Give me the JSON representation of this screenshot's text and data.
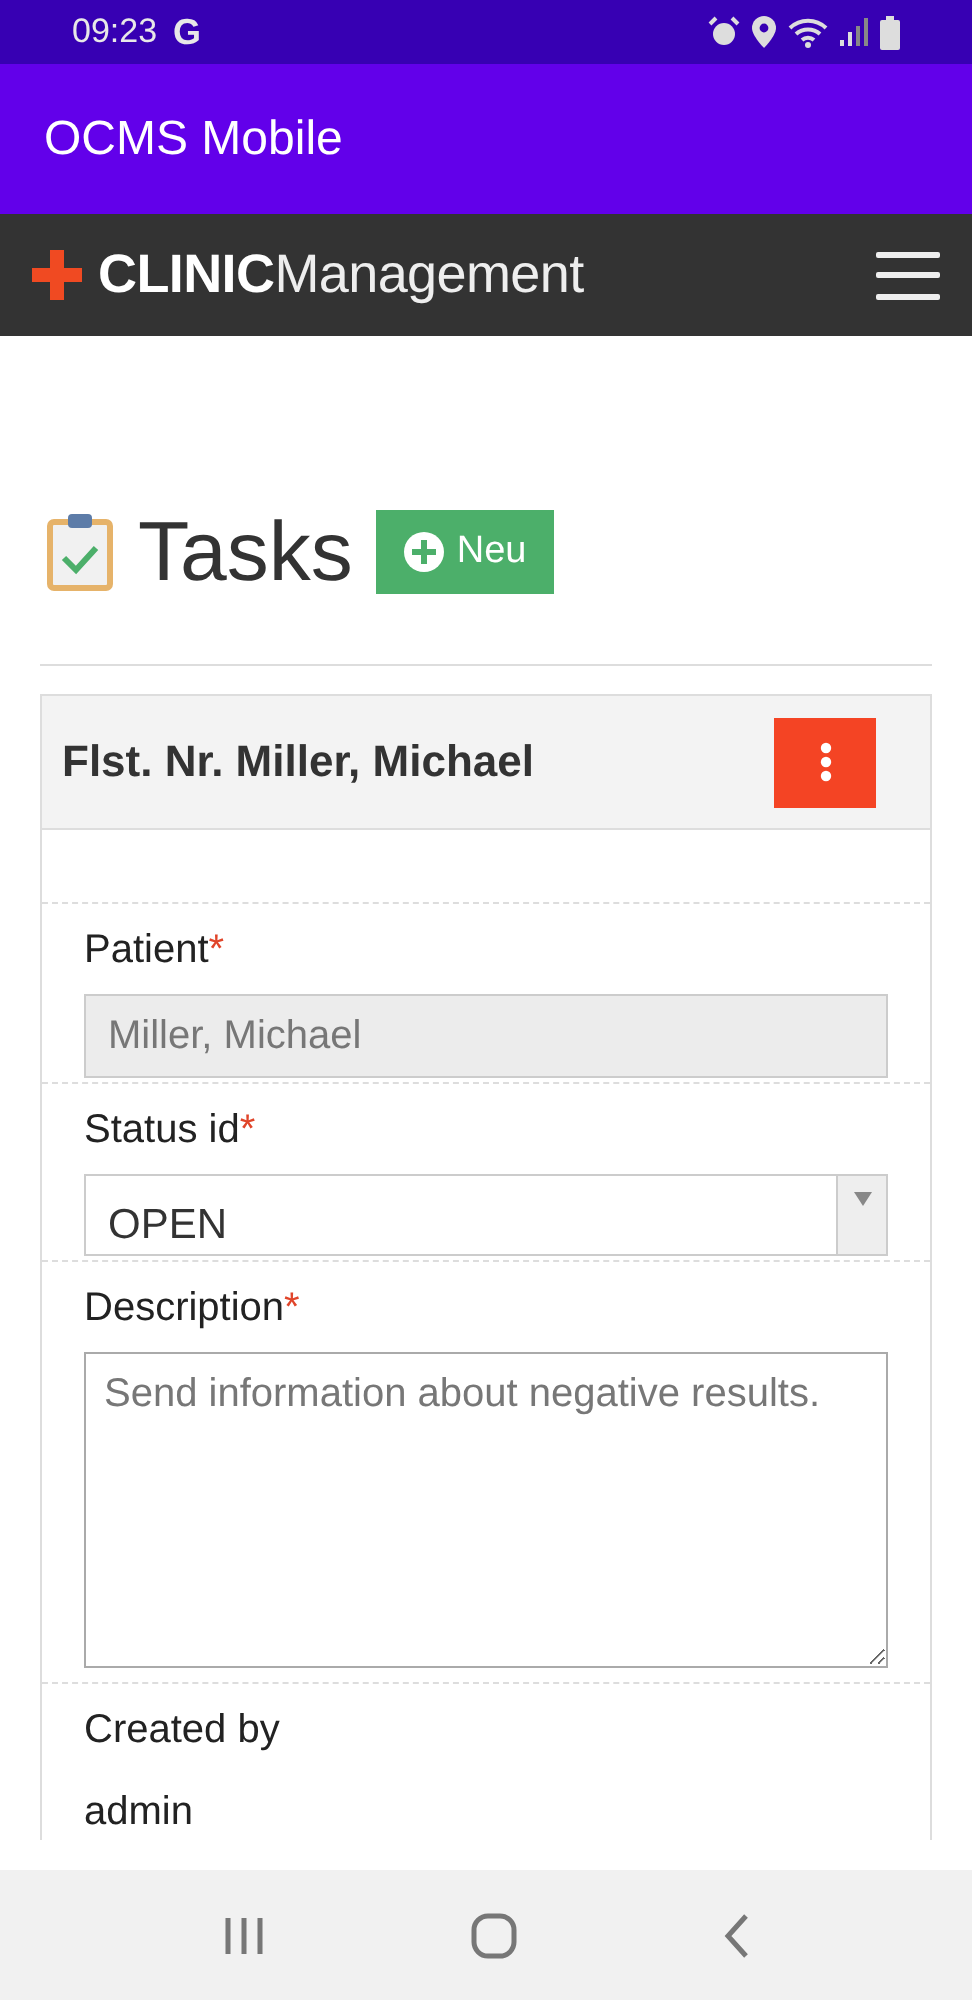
{
  "status_bar": {
    "time": "09:23",
    "notification": "G"
  },
  "app_bar": {
    "title": "OCMS Mobile"
  },
  "navbar": {
    "brand": "**CLINIC**Management"
  },
  "page": {
    "title": "Tasks",
    "new_button": "Neu"
  },
  "card": {
    "title": "Flst. Nr. Miller, Michael",
    "fields": [
      {
        "kind": "text",
        "label": "Patient",
        "required_mark": "*",
        "value": "Miller, Michael",
        "disabled": true
      },
      {
        "kind": "select",
        "label": "Status id",
        "required_mark": "*",
        "value": "OPEN",
        "disabled": false
      },
      {
        "kind": "textarea",
        "label": "Description",
        "required_mark": "*",
        "value": "Send information about negative results.",
        "disabled": false
      },
      {
        "kind": "static",
        "label": "Created by",
        "value": "admin"
      }
    ]
  }
}
